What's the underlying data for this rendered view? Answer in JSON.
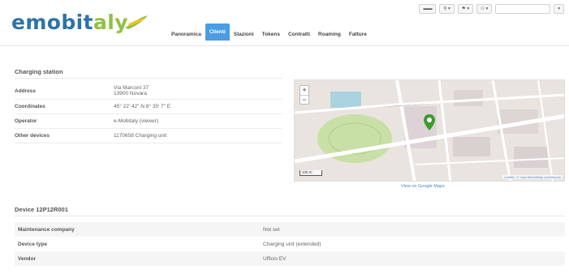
{
  "brand": {
    "name_main": "emobit",
    "name_tail": "aly"
  },
  "nav": {
    "items": [
      {
        "label": "Panoramica",
        "active": false
      },
      {
        "label": "Clienti",
        "active": true
      },
      {
        "label": "Stazioni",
        "active": false
      },
      {
        "label": "Tokens",
        "active": false
      },
      {
        "label": "Contratti",
        "active": false
      },
      {
        "label": "Roaming",
        "active": false
      },
      {
        "label": "Fatture",
        "active": false
      }
    ]
  },
  "topbar": {
    "buttons": [
      "▬▬",
      "⚲ ▾",
      "⚑ ▾",
      "⚇ ▾"
    ],
    "search_placeholder": "",
    "menu_glyph": "▾"
  },
  "station": {
    "title": "Charging station",
    "rows": [
      {
        "key": "Address",
        "value": "Via Marconi 37",
        "value2": "13900 Novara"
      },
      {
        "key": "Coordinates",
        "value": "45° 22' 42\" N   8° 35' 7\" E"
      },
      {
        "key": "Operator",
        "value": "e-Mobitaly (viewer)",
        "is_link": true
      },
      {
        "key": "Other devices",
        "value": "1170658 Charging unit",
        "is_link": true
      }
    ]
  },
  "map": {
    "caption": "View on Google Maps",
    "zoom_in": "+",
    "zoom_out": "−",
    "scale": "100 m",
    "attribution": "Leaflet | © OpenStreetMap contributors",
    "colors": {
      "land": "#e9e4df",
      "park": "#c8dfa6",
      "water": "#aad3df",
      "road": "#ffffff",
      "pin": "#3e9a2e"
    }
  },
  "device": {
    "title": "Device 12P12R001",
    "rows": [
      {
        "key": "Maintenance company",
        "value": "Not set"
      },
      {
        "key": "Device type",
        "value": "Charging unit (extended)"
      },
      {
        "key": "Vendor",
        "value": "Ufficio EV"
      }
    ]
  }
}
